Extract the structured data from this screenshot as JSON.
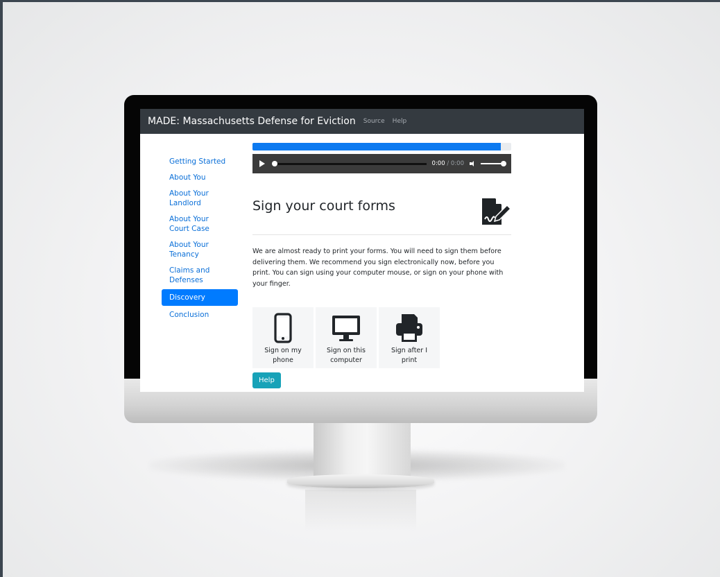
{
  "app": {
    "brand": "MADE: Massachusetts Defense for Eviction",
    "nav_links": [
      "Source",
      "Help"
    ]
  },
  "sidebar": {
    "items": [
      {
        "label": "Getting Started",
        "active": false
      },
      {
        "label": "About You",
        "active": false
      },
      {
        "label": "About Your Landlord",
        "active": false
      },
      {
        "label": "About Your Court Case",
        "active": false
      },
      {
        "label": "About Your Tenancy",
        "active": false
      },
      {
        "label": "Claims and Defenses",
        "active": false
      },
      {
        "label": "Discovery",
        "active": true
      },
      {
        "label": "Conclusion",
        "active": false
      }
    ]
  },
  "progress": {
    "percent": 96
  },
  "audio": {
    "current": "0:00",
    "separator": " / ",
    "duration": "0:00"
  },
  "main": {
    "title": "Sign your court forms",
    "title_icon": "signature-icon",
    "intro": "We are almost ready to print your forms. You will need to sign them before delivering them. We recommend you sign electronically now, before you print. You can sign using your computer mouse, or sign on your phone with your finger.",
    "options": [
      {
        "icon": "mobile-phone-icon",
        "label": "Sign on my phone"
      },
      {
        "icon": "desktop-computer-icon",
        "label": "Sign on this computer"
      },
      {
        "icon": "printer-icon",
        "label": "Sign after I print"
      }
    ],
    "help_label": "Help"
  },
  "colors": {
    "navbar": "#343a40",
    "link": "#0a6fd8",
    "active": "#007bff",
    "progress": "#0d7af0",
    "help_button": "#17a2b8"
  }
}
